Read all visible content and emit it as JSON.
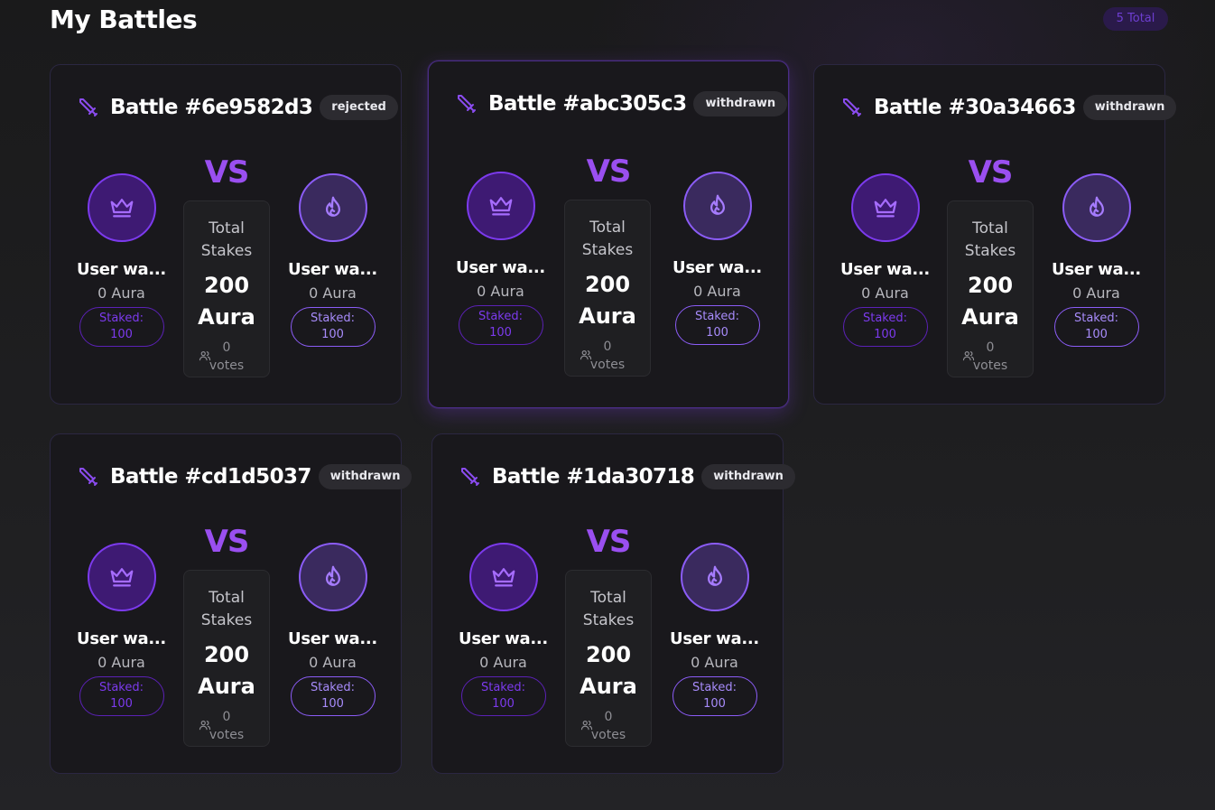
{
  "page": {
    "title": "My Battles",
    "total_badge": "5 Total"
  },
  "colors": {
    "accent": "#7c3aed",
    "vs": "#9a4ff0",
    "card_bg": "#19181c"
  },
  "battles": [
    {
      "title": "Battle #6e9582d3",
      "status": "rejected",
      "vs": "VS",
      "left": {
        "name": "User wa...",
        "aura": "0 Aura",
        "staked_label": "Staked:",
        "staked_value": "100",
        "icon": "crown-icon"
      },
      "right": {
        "name": "User wa...",
        "aura": "0 Aura",
        "staked_label": "Staked:",
        "staked_value": "100",
        "icon": "flame-icon"
      },
      "total_label_1": "Total",
      "total_label_2": "Stakes",
      "total_amount": "200",
      "total_unit": "Aura",
      "votes_count": "0",
      "votes_label": "votes"
    },
    {
      "title": "Battle #abc305c3",
      "status": "withdrawn",
      "vs": "VS",
      "left": {
        "name": "User wa...",
        "aura": "0 Aura",
        "staked_label": "Staked:",
        "staked_value": "100",
        "icon": "crown-icon"
      },
      "right": {
        "name": "User wa...",
        "aura": "0 Aura",
        "staked_label": "Staked:",
        "staked_value": "100",
        "icon": "flame-icon"
      },
      "total_label_1": "Total",
      "total_label_2": "Stakes",
      "total_amount": "200",
      "total_unit": "Aura",
      "votes_count": "0",
      "votes_label": "votes"
    },
    {
      "title": "Battle #30a34663",
      "status": "withdrawn",
      "vs": "VS",
      "left": {
        "name": "User wa...",
        "aura": "0 Aura",
        "staked_label": "Staked:",
        "staked_value": "100",
        "icon": "crown-icon"
      },
      "right": {
        "name": "User wa...",
        "aura": "0 Aura",
        "staked_label": "Staked:",
        "staked_value": "100",
        "icon": "flame-icon"
      },
      "total_label_1": "Total",
      "total_label_2": "Stakes",
      "total_amount": "200",
      "total_unit": "Aura",
      "votes_count": "0",
      "votes_label": "votes"
    },
    {
      "title": "Battle #cd1d5037",
      "status": "withdrawn",
      "vs": "VS",
      "left": {
        "name": "User wa...",
        "aura": "0 Aura",
        "staked_label": "Staked:",
        "staked_value": "100",
        "icon": "crown-icon"
      },
      "right": {
        "name": "User wa...",
        "aura": "0 Aura",
        "staked_label": "Staked:",
        "staked_value": "100",
        "icon": "flame-icon"
      },
      "total_label_1": "Total",
      "total_label_2": "Stakes",
      "total_amount": "200",
      "total_unit": "Aura",
      "votes_count": "0",
      "votes_label": "votes"
    },
    {
      "title": "Battle #1da30718",
      "status": "withdrawn",
      "vs": "VS",
      "left": {
        "name": "User wa...",
        "aura": "0 Aura",
        "staked_label": "Staked:",
        "staked_value": "100",
        "icon": "crown-icon"
      },
      "right": {
        "name": "User wa...",
        "aura": "0 Aura",
        "staked_label": "Staked:",
        "staked_value": "100",
        "icon": "flame-icon"
      },
      "total_label_1": "Total",
      "total_label_2": "Stakes",
      "total_amount": "200",
      "total_unit": "Aura",
      "votes_count": "0",
      "votes_label": "votes"
    }
  ]
}
